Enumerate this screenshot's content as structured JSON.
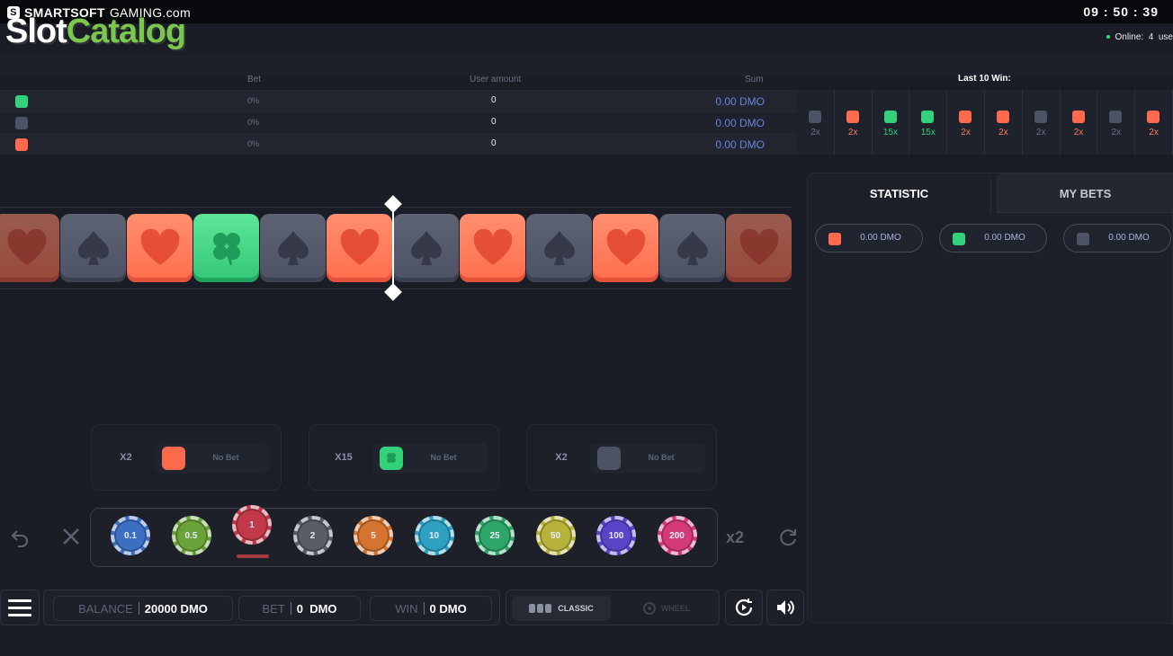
{
  "brand": {
    "name": "SMARTSOFT",
    "suffix": "GAMING.com"
  },
  "watermark": {
    "part1": "Slot",
    "part2": "Catalog"
  },
  "clock": "09 : 50 : 39",
  "online": {
    "label": "Online:",
    "count": "4",
    "suffix": "use"
  },
  "bet_table": {
    "headers": {
      "bet": "Bet",
      "user_amount": "User amount",
      "sum": "Sum"
    },
    "rows": [
      {
        "color": "#33d17a",
        "symbol": "clover",
        "pct": "0%",
        "amount": "0",
        "sum": "0.00 DMO"
      },
      {
        "color": "#4d5264",
        "symbol": "spades",
        "pct": "0%",
        "amount": "0",
        "sum": "0.00 DMO"
      },
      {
        "color": "#ff6a4d",
        "symbol": "hearts",
        "pct": "0%",
        "amount": "0",
        "sum": "0.00 DMO"
      }
    ]
  },
  "last_wins": {
    "title": "Last 10 Win:",
    "items": [
      {
        "type": "spades",
        "mult": "2x",
        "color": "#4d5264",
        "text_color": "#6c7386"
      },
      {
        "type": "hearts",
        "mult": "2x",
        "color": "#ff6a4d",
        "text_color": "#ff7a5c"
      },
      {
        "type": "clover",
        "mult": "15x",
        "color": "#33d17a",
        "text_color": "#33d17a"
      },
      {
        "type": "clover",
        "mult": "15x",
        "color": "#33d17a",
        "text_color": "#33d17a"
      },
      {
        "type": "hearts",
        "mult": "2x",
        "color": "#ff6a4d",
        "text_color": "#ff7a5c"
      },
      {
        "type": "hearts",
        "mult": "2x",
        "color": "#ff6a4d",
        "text_color": "#ff7a5c"
      },
      {
        "type": "spades",
        "mult": "2x",
        "color": "#4d5264",
        "text_color": "#6c7386"
      },
      {
        "type": "hearts",
        "mult": "2x",
        "color": "#ff6a4d",
        "text_color": "#ff7a5c"
      },
      {
        "type": "spades",
        "mult": "2x",
        "color": "#4d5264",
        "text_color": "#6c7386"
      },
      {
        "type": "hearts",
        "mult": "2x",
        "color": "#ff6a4d",
        "text_color": "#ff7a5c"
      }
    ]
  },
  "reel": [
    "hearts",
    "spades",
    "hearts",
    "clover",
    "spades",
    "hearts",
    "spades",
    "hearts",
    "spades",
    "hearts",
    "spades",
    "hearts"
  ],
  "bet_boxes": [
    {
      "mult": "X2",
      "symbol": "hearts",
      "color": "#ff6a4d",
      "status": "No Bet"
    },
    {
      "mult": "X15",
      "symbol": "clover",
      "color": "#33d17a",
      "status": "No Bet"
    },
    {
      "mult": "X2",
      "symbol": "spades",
      "color": "#4d5264",
      "status": "No Bet"
    }
  ],
  "chips": [
    {
      "value": "0.1",
      "color": "#3c6fc2"
    },
    {
      "value": "0.5",
      "color": "#6aa23a"
    },
    {
      "value": "1",
      "color": "#c23a4a",
      "selected": true
    },
    {
      "value": "2",
      "color": "#5a5d66"
    },
    {
      "value": "5",
      "color": "#d4742e"
    },
    {
      "value": "10",
      "color": "#2ea0c2"
    },
    {
      "value": "25",
      "color": "#2ea66a"
    },
    {
      "value": "50",
      "color": "#b6b23a"
    },
    {
      "value": "100",
      "color": "#5a44c8"
    },
    {
      "value": "200",
      "color": "#d43a7a"
    }
  ],
  "double_label": "x2",
  "stats_panel": {
    "tabs": {
      "statistic": "STATISTIC",
      "my_bets": "MY BETS"
    },
    "pills": [
      {
        "color": "#ff6a4d",
        "value": "0.00 DMO"
      },
      {
        "color": "#33d17a",
        "value": "0.00 DMO"
      },
      {
        "color": "#4d5264",
        "value": "0.00 DMO"
      }
    ]
  },
  "bottom": {
    "balance_label": "BALANCE",
    "balance_value": "20000 DMO",
    "bet_label": "BET",
    "bet_value": "0  DMO",
    "win_label": "WIN",
    "win_value": "0 DMO",
    "mode_classic": "CLASSIC",
    "mode_wheel": "WHEEL"
  }
}
